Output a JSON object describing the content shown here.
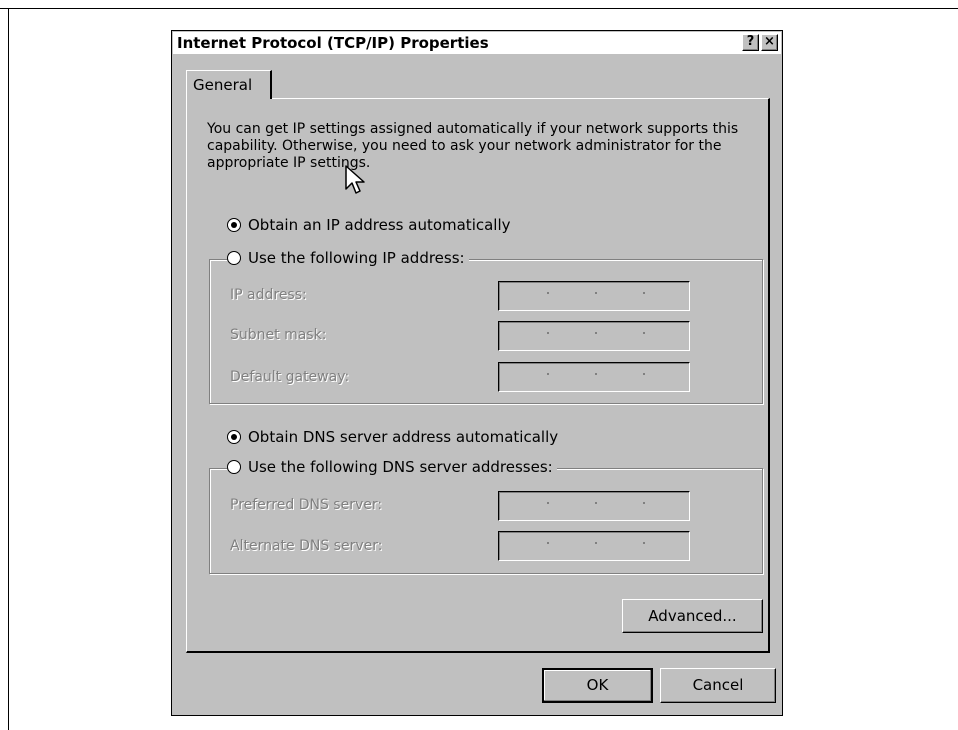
{
  "dialog": {
    "title": "Internet Protocol (TCP/IP) Properties",
    "help_label": "?",
    "close_label": "×"
  },
  "tabs": [
    {
      "label": "General",
      "selected": true
    }
  ],
  "intro_text": "You can get IP settings assigned automatically if your network supports this capability. Otherwise, you need to ask your network administrator for the appropriate IP settings.",
  "ip": {
    "auto_label": "Obtain an IP address automatically",
    "auto_selected": true,
    "manual_label": "Use the following IP address:",
    "manual_selected": false,
    "fields": [
      {
        "label": "IP address:",
        "value": ""
      },
      {
        "label": "Subnet mask:",
        "value": ""
      },
      {
        "label": "Default gateway:",
        "value": ""
      }
    ]
  },
  "dns": {
    "auto_label": "Obtain DNS server address automatically",
    "auto_selected": true,
    "manual_label": "Use the following DNS server addresses:",
    "manual_selected": false,
    "fields": [
      {
        "label": "Preferred DNS server:",
        "value": ""
      },
      {
        "label": "Alternate DNS server:",
        "value": ""
      }
    ]
  },
  "buttons": {
    "advanced": "Advanced...",
    "ok": "OK",
    "cancel": "Cancel"
  },
  "icons": {
    "cursor": "arrow-cursor-icon"
  }
}
